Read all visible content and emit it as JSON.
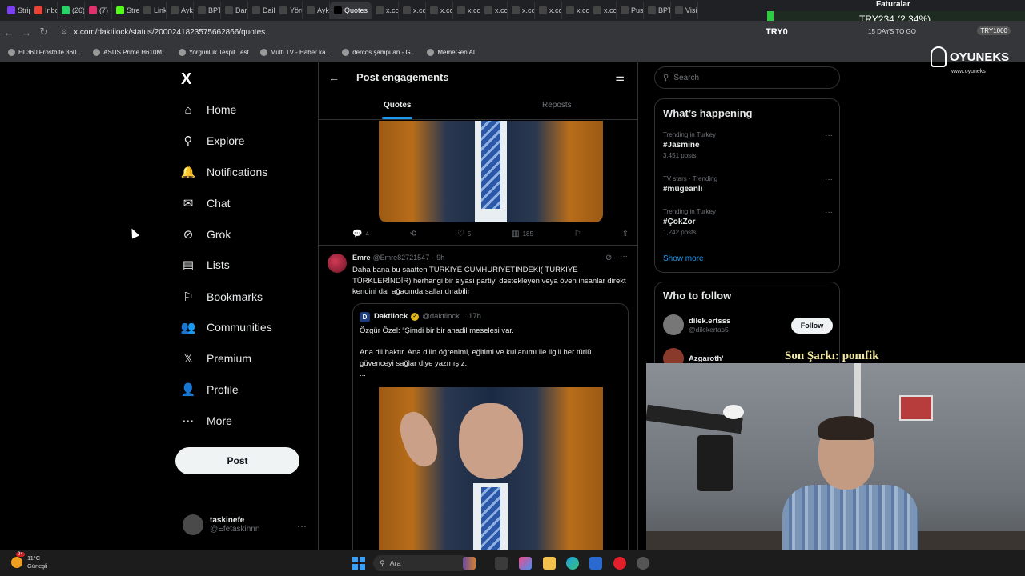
{
  "browser": {
    "tabs": [
      {
        "label": "Strip",
        "color": "#7a3ff5"
      },
      {
        "label": "Inbo",
        "color": "#ea4335"
      },
      {
        "label": "(26)",
        "color": "#25d366"
      },
      {
        "label": "(7) I",
        "color": "#e1306c"
      },
      {
        "label": "Stre",
        "color": "#53fc18"
      },
      {
        "label": "Link",
        "color": "#444444"
      },
      {
        "label": "Aykı",
        "color": "#444444"
      },
      {
        "label": "BPT",
        "color": "#444444"
      },
      {
        "label": "Darı",
        "color": "#444444"
      },
      {
        "label": "Daily",
        "color": "#444444"
      },
      {
        "label": "Yörü",
        "color": "#444444"
      },
      {
        "label": "Aykı",
        "color": "#444444"
      },
      {
        "label": "Quotes",
        "color": "#000000",
        "active": true
      },
      {
        "label": "x.co",
        "color": "#444444"
      },
      {
        "label": "x.co",
        "color": "#444444"
      },
      {
        "label": "x.co",
        "color": "#444444"
      },
      {
        "label": "x.co",
        "color": "#444444"
      },
      {
        "label": "x.co",
        "color": "#444444"
      },
      {
        "label": "x.co",
        "color": "#444444"
      },
      {
        "label": "x.co",
        "color": "#444444"
      },
      {
        "label": "x.co",
        "color": "#444444"
      },
      {
        "label": "x.co",
        "color": "#444444"
      },
      {
        "label": "Pusl",
        "color": "#444444"
      },
      {
        "label": "BPT",
        "color": "#444444"
      },
      {
        "label": "Visi",
        "color": "#444444"
      }
    ],
    "ticker": "TRY234 (2.34%)",
    "faturalar": "Faturalar",
    "url": "x.com/daktilock/status/2000241823575662866/quotes",
    "try0": "TRY0",
    "days_to_go": "15 DAYS TO GO",
    "try_badge": "TRY1000",
    "bookmarks": [
      "HL360 Frostbite 360...",
      "ASUS Prime H610M...",
      "Yorgunluk Tespit Test",
      "Multi TV - Haber ka...",
      "dercos şampuan - G...",
      "MemeGen AI"
    ]
  },
  "overlay": {
    "brand": "OYUNEKS",
    "brand_sub": "www.oyuneks",
    "song": "Son Şarkı: pomfik"
  },
  "nav": {
    "logo": "X",
    "items": [
      {
        "label": "Home",
        "icon": "home-icon",
        "glyph": "⌂"
      },
      {
        "label": "Explore",
        "icon": "search-icon",
        "glyph": "⚲"
      },
      {
        "label": "Notifications",
        "icon": "bell-icon",
        "glyph": "🔔"
      },
      {
        "label": "Chat",
        "icon": "mail-icon",
        "glyph": "✉"
      },
      {
        "label": "Grok",
        "icon": "grok-icon",
        "glyph": "⊘"
      },
      {
        "label": "Lists",
        "icon": "list-icon",
        "glyph": "▤"
      },
      {
        "label": "Bookmarks",
        "icon": "bookmark-icon",
        "glyph": "⚐"
      },
      {
        "label": "Communities",
        "icon": "communities-icon",
        "glyph": "👥"
      },
      {
        "label": "Premium",
        "icon": "x-premium-icon",
        "glyph": "𝕏"
      },
      {
        "label": "Profile",
        "icon": "profile-icon",
        "glyph": "👤"
      },
      {
        "label": "More",
        "icon": "more-icon",
        "glyph": "⋯"
      }
    ],
    "post_label": "Post",
    "account": {
      "name": "taskinefe",
      "handle": "@Efetaskinnn"
    }
  },
  "main": {
    "title": "Post engagements",
    "tabs": {
      "quotes": "Quotes",
      "reposts": "Reposts"
    },
    "first_post_actions": {
      "replies": "4",
      "likes": "5",
      "views": "185"
    },
    "post": {
      "name": "Emre",
      "handle": "@Emre82721547",
      "time": "9h",
      "text": "Daha bana bu saatten TÜRKİYE CUMHURİYETİNDEKİ( TÜRKİYE TÜRKLERİNDİR) herhangi bir siyasi partiyi destekleyen veya öven insanlar direkt kendini dar ağacında sallandırabilir",
      "quote": {
        "avatar_letter": "D",
        "name": "Daktilock",
        "handle": "@daktilock",
        "time": "17h",
        "line1": "Özgür Özel: “Şimdi bir bir anadil meselesi var.",
        "line2": "Ana dil haktır. Ana dilin öğrenimi, eğitimi ve kullanımı ile ilgili her türlü güvenceyi sağlar diye yazmışız.",
        "ellipsis": "..."
      }
    }
  },
  "sidebar": {
    "search_placeholder": "Search",
    "happening_title": "What’s happening",
    "trends": [
      {
        "meta": "Trending in Turkey",
        "name": "#Jasmine",
        "posts": "3,451 posts"
      },
      {
        "meta": "TV stars · Trending",
        "name": "#mügeanlı",
        "posts": ""
      },
      {
        "meta": "Trending in Turkey",
        "name": "#ÇokZor",
        "posts": "1,242 posts"
      }
    ],
    "show_more": "Show more",
    "who_to_follow_title": "Who to follow",
    "follow": [
      {
        "name": "dilek.ertsss",
        "handle": "@dilekertas5"
      },
      {
        "name": "Azgaroth'",
        "handle": ""
      }
    ],
    "follow_label": "Follow"
  },
  "taskbar": {
    "temp": "11°C",
    "weather_text": "Güneşli",
    "weather_badge": "94",
    "search_placeholder": "Ara"
  }
}
